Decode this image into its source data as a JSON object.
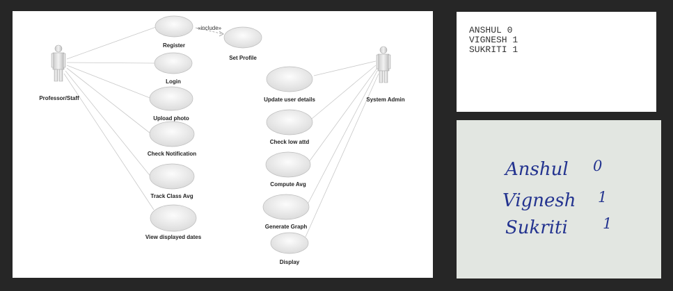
{
  "diagram": {
    "actors": {
      "left": "Professor/Staff",
      "right": "System Admin"
    },
    "use_cases_left": [
      "Register",
      "Login",
      "Upload photo",
      "Check Notification",
      "Track Class Avg",
      "View displayed dates"
    ],
    "use_cases_right": [
      "Update user details",
      "Check low attd",
      "Compute Avg",
      "Generate Graph",
      "Display"
    ],
    "extra_use_case": "Set Profile",
    "include_label": "«include»"
  },
  "text_output": {
    "lines": [
      "ANSHUL 0",
      "VIGNESH 1",
      "SUKRITI 1"
    ]
  },
  "handwritten": {
    "rows": [
      {
        "name": "Anshul",
        "value": "0"
      },
      {
        "name": "Vignesh",
        "value": "1"
      },
      {
        "name": "Sukriti",
        "value": "1"
      }
    ]
  }
}
